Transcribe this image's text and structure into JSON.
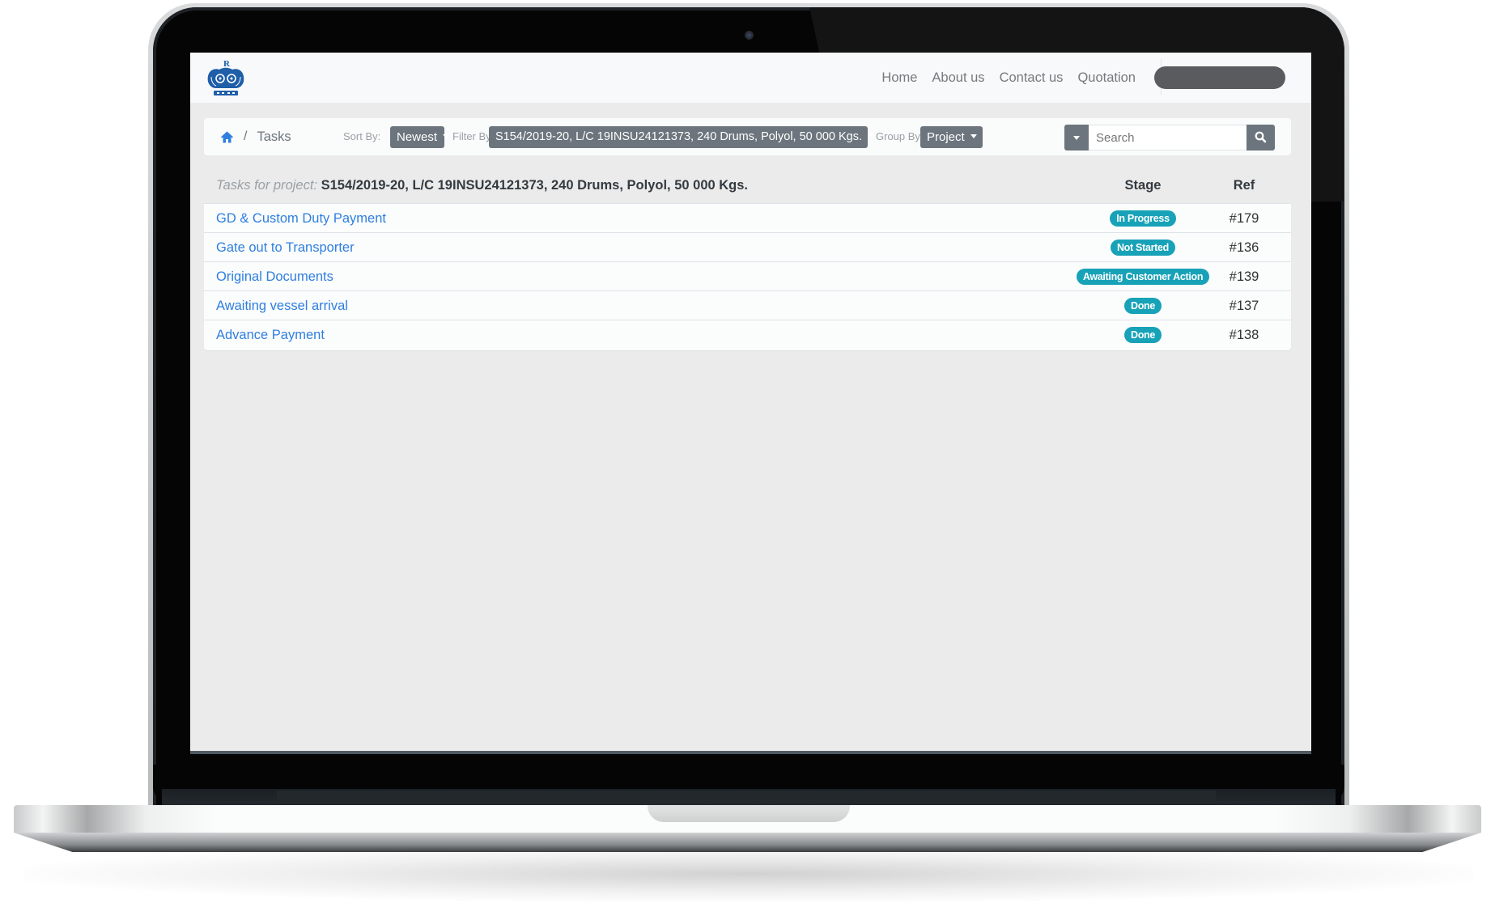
{
  "navbar": {
    "logo": "crown-logo",
    "links": [
      {
        "label": "Home"
      },
      {
        "label": "About us"
      },
      {
        "label": "Contact us"
      },
      {
        "label": "Quotation"
      }
    ]
  },
  "toolbar": {
    "breadcrumb": {
      "home_icon": "home-icon",
      "separator": "/",
      "current": "Tasks"
    },
    "sort": {
      "label": "Sort By:",
      "value": "Newest"
    },
    "filter": {
      "label": "Filter By:",
      "value": "S154/2019-20, L/C 19INSU24121373, 240 Drums, Polyol, 50 000 Kgs."
    },
    "group": {
      "label": "Group By:",
      "value": "Project"
    },
    "search": {
      "placeholder": "Search",
      "value": "",
      "icon": "search-icon"
    }
  },
  "table": {
    "project_prefix": "Tasks for project:",
    "project_name": "S154/2019-20, L/C 19INSU24121373, 240 Drums, Polyol, 50 000 Kgs.",
    "columns": {
      "stage": "Stage",
      "ref": "Ref"
    },
    "rows": [
      {
        "name": "GD & Custom Duty Payment",
        "stage": "In Progress",
        "ref": "#179"
      },
      {
        "name": "Gate out to Transporter",
        "stage": "Not Started",
        "ref": "#136"
      },
      {
        "name": "Original Documents",
        "stage": "Awaiting Customer Action",
        "ref": "#139"
      },
      {
        "name": "Awaiting vessel arrival",
        "stage": "Done",
        "ref": "#137"
      },
      {
        "name": "Advance Payment",
        "stage": "Done",
        "ref": "#138"
      }
    ]
  },
  "colors": {
    "link": "#2e7fe0",
    "badge": "#17a2b8",
    "button": "#6c757d",
    "logo": "#1f5ea8"
  }
}
